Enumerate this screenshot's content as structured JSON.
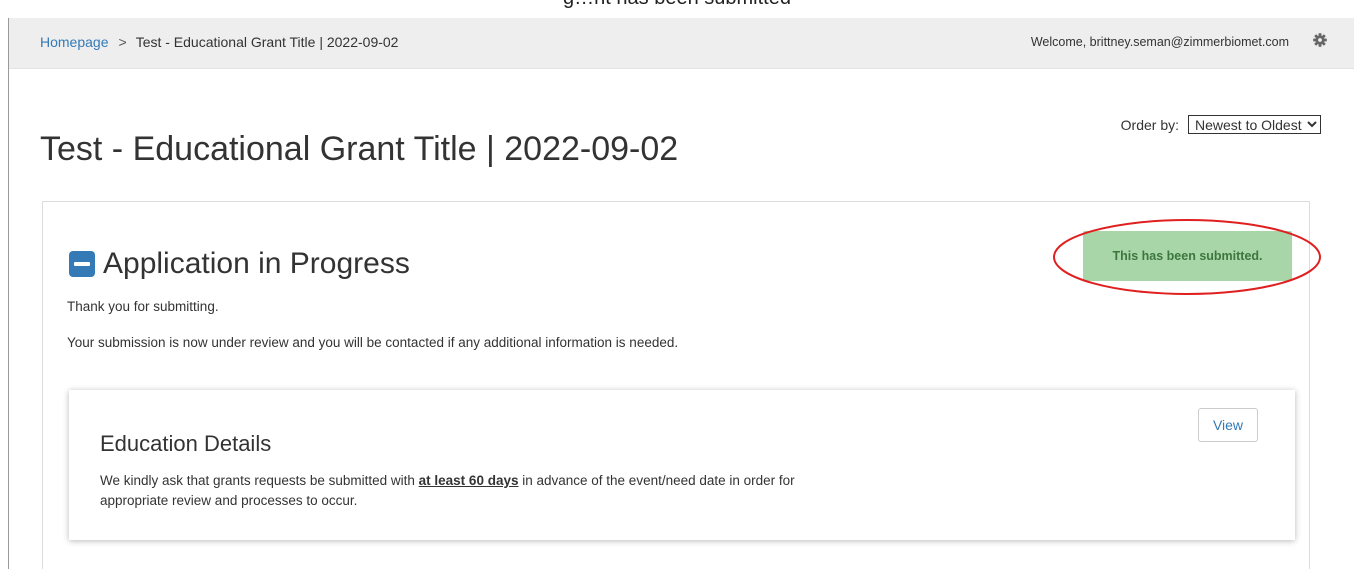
{
  "caption": "g…nt has been submitted",
  "breadcrumb": {
    "home": "Homepage",
    "separator": ">",
    "current": "Test - Educational Grant Title | 2022-09-02"
  },
  "header": {
    "welcome": "Welcome, brittney.seman@zimmerbiomet.com",
    "settings_icon": "gear-icon"
  },
  "order_by": {
    "label": "Order by:",
    "selected": "Newest to Oldest"
  },
  "page_title": "Test - Educational Grant Title | 2022-09-02",
  "application": {
    "toggle_icon": "minus-square-icon",
    "title": "Application in Progress",
    "thanks": "Thank you for submitting.",
    "review_message": "Your submission is now under review and you will be contacted if any additional information is needed.",
    "status_badge": "This has been submitted.",
    "annotation_color": "#e02020"
  },
  "education_card": {
    "title": "Education Details",
    "text_before": "We kindly ask that grants requests be submitted with ",
    "text_bold": "at least 60 days",
    "text_after": " in advance of the event/need date in order for appropriate review and processes to occur.",
    "view_button": "View"
  },
  "colors": {
    "link": "#337ab7",
    "badge_bg": "#a9d6a9",
    "badge_text": "#3c763d",
    "topbar_bg": "#eeeeee"
  }
}
